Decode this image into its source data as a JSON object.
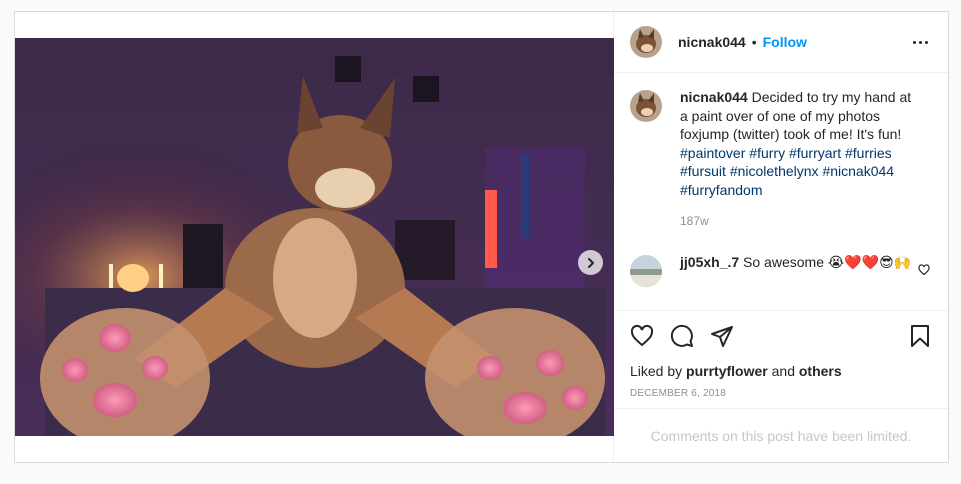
{
  "post": {
    "author": "nicnak044",
    "separator": "•",
    "follow_label": "Follow",
    "carousel": {
      "slide_count": 2,
      "active_slide": 1
    }
  },
  "caption": {
    "username": "nicnak044",
    "text": "Decided to try my hand at a paint over of one of my photos foxjump (twitter) took of me! It's fun!",
    "hashtags": [
      "#paintover",
      "#furry",
      "#furryart",
      "#furries",
      "#fursuit",
      "#nicolethelynx",
      "#nicnak044",
      "#furryfandom"
    ],
    "time": "187w"
  },
  "comment": {
    "username": "jj05xh_.7",
    "text": "So awesome 😭❤️❤️😎🙌"
  },
  "likes": {
    "prefix": "Liked by",
    "user": "purrtyflower",
    "joiner": "and",
    "others": "others"
  },
  "date": "DECEMBER 6, 2018",
  "limited_notice": "Comments on this post have been limited.",
  "icons": {
    "more": "more-options-icon",
    "next": "chevron-right-icon",
    "like": "heart-icon",
    "comment": "comment-icon",
    "share": "paper-plane-icon",
    "save": "bookmark-icon"
  },
  "colors": {
    "link": "#0095f6",
    "hashtag": "#00376b",
    "muted": "#8e8e8e"
  }
}
